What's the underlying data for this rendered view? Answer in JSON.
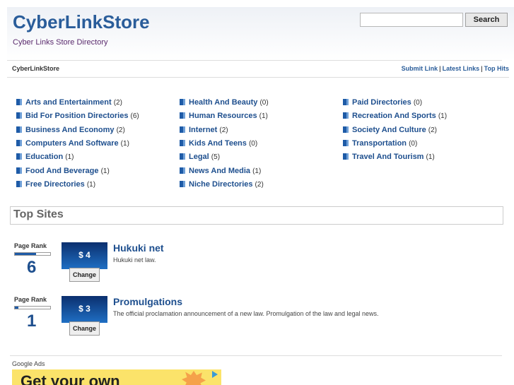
{
  "header": {
    "title": "CyberLinkStore",
    "tagline": "Cyber Links Store Directory",
    "search_placeholder": "",
    "search_button": "Search"
  },
  "nav": {
    "breadcrumb": "CyberLinkStore",
    "links": [
      {
        "label": "Submit Link"
      },
      {
        "label": "Latest Links"
      },
      {
        "label": "Top Hits"
      }
    ],
    "separator": "|"
  },
  "categories": {
    "col1": [
      {
        "name": "Arts and Entertainment",
        "count": "(2)"
      },
      {
        "name": "Bid For Position Directories",
        "count": "(6)"
      },
      {
        "name": "Business And Economy",
        "count": "(2)"
      },
      {
        "name": "Computers And Software",
        "count": "(1)"
      },
      {
        "name": "Education",
        "count": "(1)"
      },
      {
        "name": "Food And Beverage",
        "count": "(1)"
      },
      {
        "name": "Free Directories",
        "count": "(1)"
      }
    ],
    "col2": [
      {
        "name": "Health And Beauty",
        "count": "(0)"
      },
      {
        "name": "Human Resources",
        "count": "(1)"
      },
      {
        "name": "Internet",
        "count": "(2)"
      },
      {
        "name": "Kids And Teens",
        "count": "(0)"
      },
      {
        "name": "Legal",
        "count": "(5)"
      },
      {
        "name": "News And Media",
        "count": "(1)"
      },
      {
        "name": "Niche Directories",
        "count": "(2)"
      }
    ],
    "col3": [
      {
        "name": "Paid Directories",
        "count": "(0)"
      },
      {
        "name": "Recreation And Sports",
        "count": "(1)"
      },
      {
        "name": "Society And Culture",
        "count": "(2)"
      },
      {
        "name": "Transportation",
        "count": "(0)"
      },
      {
        "name": "Travel And Tourism",
        "count": "(1)"
      }
    ]
  },
  "top_sites": {
    "heading": "Top Sites",
    "items": [
      {
        "pr_label": "Page Rank",
        "rank": "6",
        "rank_fraction": 0.6,
        "price": "$ 4",
        "change_label": "Change",
        "title": "Hukuki net",
        "desc": "Hukuki net law."
      },
      {
        "pr_label": "Page Rank",
        "rank": "1",
        "rank_fraction": 0.1,
        "price": "$ 3",
        "change_label": "Change",
        "title": "Promulgations",
        "desc": "The official proclamation announcement of a new law. Promulgation of the law and legal news."
      }
    ]
  },
  "ads": {
    "label": "Google Ads",
    "banner_text": "Get your own"
  }
}
